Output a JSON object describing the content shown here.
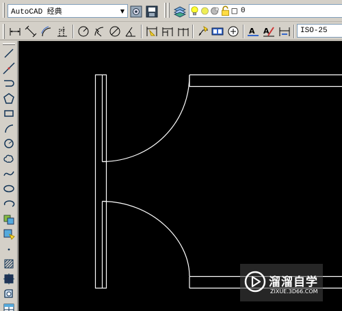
{
  "workspace": {
    "value": "AutoCAD 经典"
  },
  "layer": {
    "value": "0"
  },
  "dim_style": {
    "value": "ISO-25"
  },
  "watermark": {
    "title": "溜溜自学",
    "subtitle": "ZIXUE.3D66.COM"
  },
  "colors": {
    "canvas": "#000000",
    "lines": "#ffffff",
    "toolbar": "#d4d0c8"
  },
  "icons": {
    "row1": [
      "workspace-settings-icon",
      "workspace-save-icon",
      "layer-manager-icon",
      "bulb-on-icon",
      "sun-icon",
      "freeze-viewport-icon",
      "lock-icon",
      "layer-color-icon"
    ],
    "row2": [
      "linear-dim-icon",
      "aligned-dim-icon",
      "arc-length-icon",
      "ordinate-dim-icon",
      "radius-dim-icon",
      "jogged-dim-icon",
      "diameter-dim-icon",
      "angular-dim-icon",
      "quick-dim-icon",
      "baseline-dim-icon",
      "continue-dim-icon",
      "quick-leader-icon",
      "tolerance-icon",
      "center-mark-icon",
      "dim-edit-icon",
      "dim-text-edit-icon",
      "dim-update-icon"
    ],
    "left": [
      "line-icon",
      "construction-line-icon",
      "polyline-icon",
      "polygon-icon",
      "rectangle-icon",
      "arc-icon",
      "circle-icon",
      "revision-cloud-icon",
      "spline-icon",
      "ellipse-icon",
      "ellipse-arc-icon",
      "insert-block-icon",
      "make-block-icon",
      "point-icon",
      "hatch-icon",
      "gradient-icon",
      "region-icon",
      "table-icon"
    ]
  }
}
